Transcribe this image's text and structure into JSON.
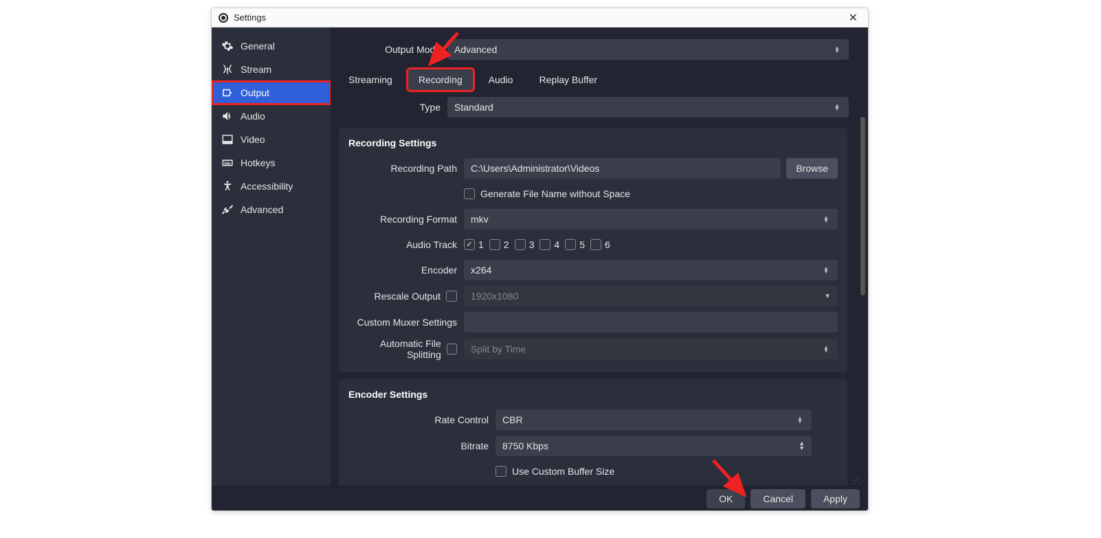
{
  "titlebar": {
    "title": "Settings"
  },
  "sidebar": {
    "items": [
      {
        "label": "General"
      },
      {
        "label": "Stream"
      },
      {
        "label": "Output"
      },
      {
        "label": "Audio"
      },
      {
        "label": "Video"
      },
      {
        "label": "Hotkeys"
      },
      {
        "label": "Accessibility"
      },
      {
        "label": "Advanced"
      }
    ]
  },
  "main": {
    "output_mode_label": "Output Mode",
    "output_mode_value": "Advanced",
    "tabs": [
      {
        "label": "Streaming"
      },
      {
        "label": "Recording"
      },
      {
        "label": "Audio"
      },
      {
        "label": "Replay Buffer"
      }
    ],
    "type_label": "Type",
    "type_value": "Standard"
  },
  "recording": {
    "section_title": "Recording Settings",
    "path_label": "Recording Path",
    "path_value": "C:\\Users\\Administrator\\Videos",
    "browse_label": "Browse",
    "filename_checkbox_label": "Generate File Name without Space",
    "format_label": "Recording Format",
    "format_value": "mkv",
    "audio_track_label": "Audio Track",
    "tracks": [
      "1",
      "2",
      "3",
      "4",
      "5",
      "6"
    ],
    "encoder_label": "Encoder",
    "encoder_value": "x264",
    "rescale_label": "Rescale Output",
    "rescale_placeholder": "1920x1080",
    "muxer_label": "Custom Muxer Settings",
    "split_label": "Automatic File Splitting",
    "split_value": "Split by Time"
  },
  "encoder": {
    "section_title": "Encoder Settings",
    "rate_label": "Rate Control",
    "rate_value": "CBR",
    "bitrate_label": "Bitrate",
    "bitrate_value": "8750 Kbps",
    "custom_buffer_label": "Use Custom Buffer Size"
  },
  "footer": {
    "ok": "OK",
    "cancel": "Cancel",
    "apply": "Apply"
  }
}
